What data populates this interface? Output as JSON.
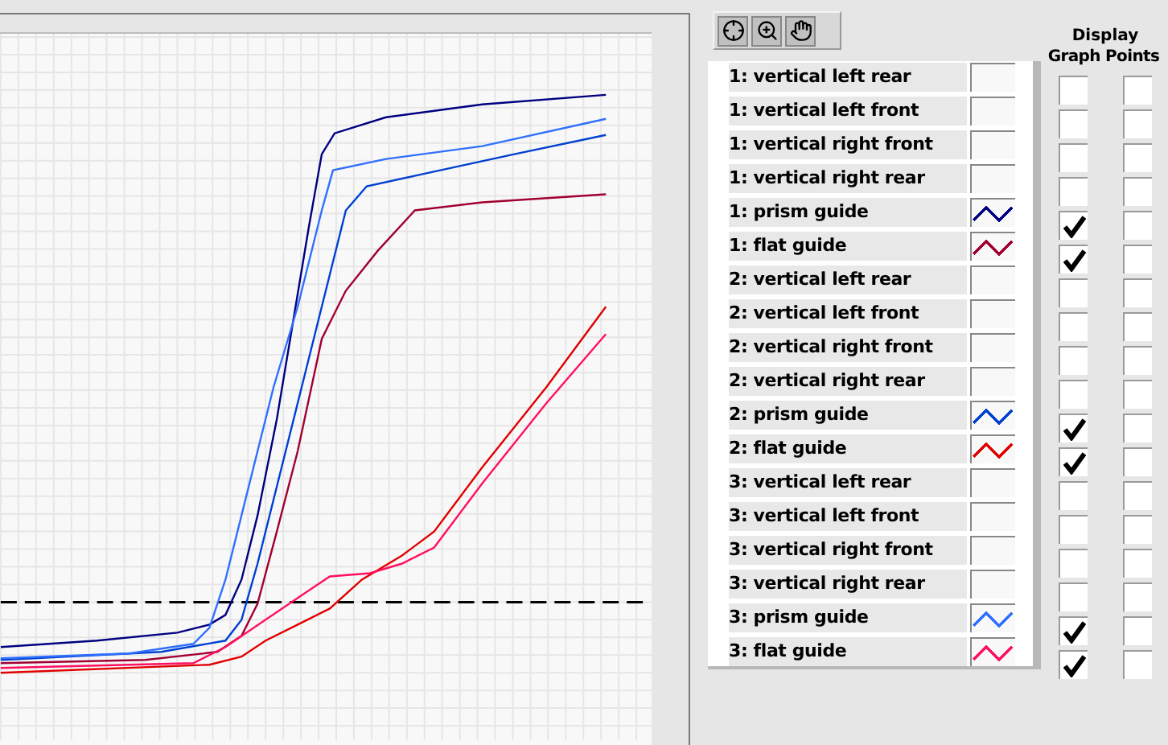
{
  "toolbar": {
    "tools": [
      {
        "kind": "cursor"
      },
      {
        "kind": "zoom"
      },
      {
        "kind": "pan"
      }
    ]
  },
  "legend": {
    "header": {
      "title": "Display",
      "columns": [
        "Graph",
        "Points"
      ]
    },
    "rows": [
      {
        "label": "1: vertical left rear",
        "graph": false,
        "points": false
      },
      {
        "label": "1: vertical left front",
        "graph": false,
        "points": false
      },
      {
        "label": "1: vertical right front",
        "graph": false,
        "points": false
      },
      {
        "label": "1: vertical right rear",
        "graph": false,
        "points": false
      },
      {
        "label": "1: prism guide",
        "color": "#000080",
        "graph": true,
        "points": false
      },
      {
        "label": "1: flat guide",
        "color": "#a00030",
        "graph": true,
        "points": false
      },
      {
        "label": "2: vertical left rear",
        "graph": false,
        "points": false
      },
      {
        "label": "2: vertical left front",
        "graph": false,
        "points": false
      },
      {
        "label": "2: vertical right front",
        "graph": false,
        "points": false
      },
      {
        "label": "2: vertical right rear",
        "graph": false,
        "points": false
      },
      {
        "label": "2: prism guide",
        "color": "#0040d0",
        "graph": true,
        "points": false
      },
      {
        "label": "2: flat guide",
        "color": "#e00000",
        "graph": true,
        "points": false
      },
      {
        "label": "3: vertical left rear",
        "graph": false,
        "points": false
      },
      {
        "label": "3: vertical left front",
        "graph": false,
        "points": false
      },
      {
        "label": "3: vertical right front",
        "graph": false,
        "points": false
      },
      {
        "label": "3: vertical right rear",
        "graph": false,
        "points": false
      },
      {
        "label": "3: prism guide",
        "color": "#3070ff",
        "graph": true,
        "points": false
      },
      {
        "label": "3: flat guide",
        "color": "#ff1060",
        "graph": true,
        "points": false
      }
    ]
  }
}
